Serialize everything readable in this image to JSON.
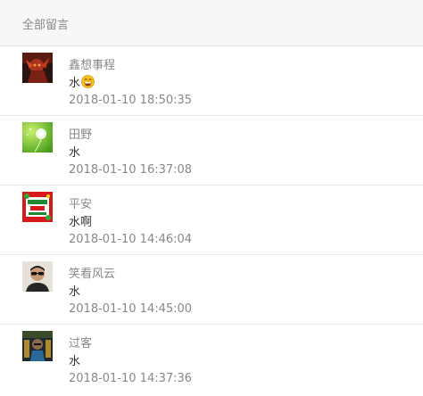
{
  "header": {
    "title": "全部留言"
  },
  "comments": [
    {
      "username": "鑫想事程",
      "text": "水",
      "emoji": "laughing-face",
      "time": "2018-01-10 18:50:35",
      "avatar": "dark-red-figure-icon"
    },
    {
      "username": "田野",
      "text": "水",
      "time": "2018-01-10 16:37:08",
      "avatar": "green-dandelion-icon"
    },
    {
      "username": "平安",
      "text": "水啊",
      "time": "2018-01-10 14:46:04",
      "avatar": "red-green-festive-icon"
    },
    {
      "username": "笑看风云",
      "text": "水",
      "time": "2018-01-10 14:45:00",
      "avatar": "man-sunglasses-icon"
    },
    {
      "username": "过客",
      "text": "水",
      "time": "2018-01-10 14:37:36",
      "avatar": "dark-figure-icon"
    }
  ]
}
